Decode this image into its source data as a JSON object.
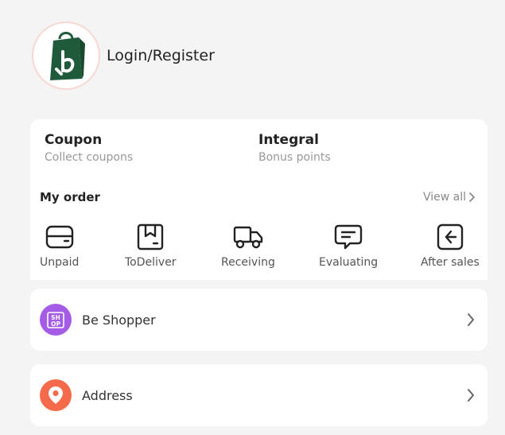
{
  "profile": {
    "avatar_icon": "shopping-bag-logo-icon",
    "login_label": "Login/Register"
  },
  "stats": {
    "coupon": {
      "title": "Coupon",
      "subtitle": "Collect coupons"
    },
    "integral": {
      "title": "Integral",
      "subtitle": "Bonus points"
    }
  },
  "orders": {
    "title": "My order",
    "view_all": "View all",
    "items": [
      {
        "label": "Unpaid",
        "icon": "wallet-icon"
      },
      {
        "label": "ToDeliver",
        "icon": "package-icon"
      },
      {
        "label": "Receiving",
        "icon": "truck-icon"
      },
      {
        "label": "Evaluating",
        "icon": "comment-icon"
      },
      {
        "label": "After sales",
        "icon": "return-icon"
      }
    ]
  },
  "menu": {
    "shopper": {
      "label": "Be Shopper",
      "icon": "shop-icon",
      "color": "#a45ce6"
    },
    "address": {
      "label": "Address",
      "icon": "location-pin-icon",
      "color": "#f56a4a"
    }
  },
  "colors": {
    "brand_green": "#1f5a3a",
    "background": "#f4f4f4",
    "muted_text": "#999999"
  }
}
